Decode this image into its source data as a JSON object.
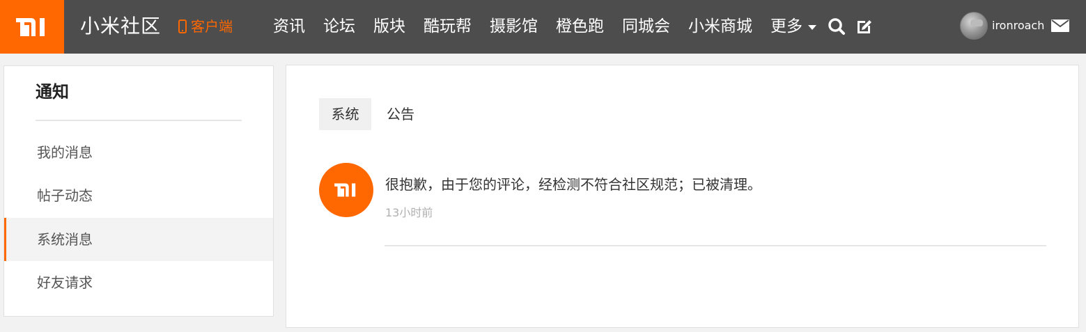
{
  "header": {
    "logo_icon": "mi-logo-icon",
    "site_title": "小米社区",
    "client_label": "客户端",
    "nav": [
      "资讯",
      "论坛",
      "版块",
      "酷玩帮",
      "摄影馆",
      "橙色跑",
      "同城会",
      "小米商城"
    ],
    "more_label": "更多",
    "username": "ironroach",
    "colors": {
      "bar": "#4d4d4d",
      "accent": "#ff6700"
    }
  },
  "sidebar": {
    "title": "通知",
    "items": [
      {
        "label": "我的消息",
        "active": false
      },
      {
        "label": "帖子动态",
        "active": false
      },
      {
        "label": "系统消息",
        "active": true
      },
      {
        "label": "好友请求",
        "active": false
      }
    ]
  },
  "main": {
    "tabs": [
      {
        "label": "系统",
        "active": true
      },
      {
        "label": "公告",
        "active": false
      }
    ],
    "messages": [
      {
        "icon": "mi-logo-icon",
        "text": "很抱歉，由于您的评论，经检测不符合社区规范；已被清理。",
        "time": "13小时前"
      }
    ]
  }
}
